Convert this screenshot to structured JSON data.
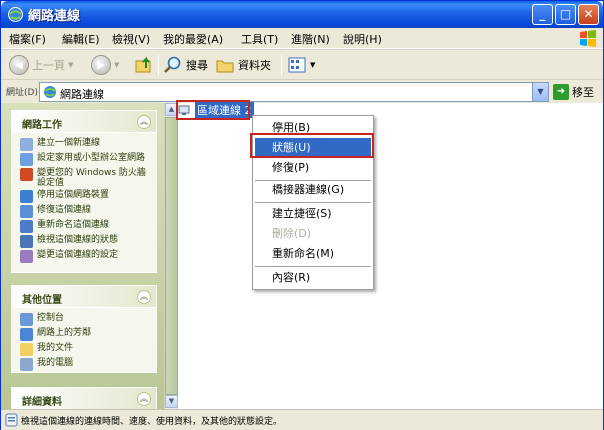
{
  "window": {
    "title": "網路連線",
    "minimize": "_",
    "maximize": "□",
    "close": "✕"
  },
  "menubar": {
    "items": [
      "檔案(F)",
      "編輯(E)",
      "檢視(V)",
      "我的最愛(A)",
      "工具(T)",
      "進階(N)",
      "說明(H)"
    ]
  },
  "toolbar": {
    "back": "上一頁",
    "search": "搜尋",
    "folders": "資料夾"
  },
  "address": {
    "label": "網址(D)",
    "value": "網路連線",
    "go": "移至"
  },
  "taskpane": {
    "network_tasks": {
      "title": "網路工作",
      "items": [
        "建立一個新連線",
        "設定家用或小型辦公室網路",
        "變更您的 Windows 防火牆設定值",
        "停用這個網路裝置",
        "修復這個連線",
        "重新命名這個連線",
        "檢視這個連線的狀態",
        "變更這個連線的設定"
      ]
    },
    "other_places": {
      "title": "其他位置",
      "items": [
        "控制台",
        "網路上的芳鄰",
        "我的文件",
        "我的電腦"
      ]
    },
    "details": {
      "title": "詳細資料"
    }
  },
  "content": {
    "selected_item": "區域連線 2"
  },
  "context_menu": {
    "items": [
      {
        "label": "停用(B)",
        "state": "normal"
      },
      {
        "label": "狀態(U)",
        "state": "selected"
      },
      {
        "label": "修復(P)",
        "state": "normal"
      },
      {
        "label": "橋接器連線(G)",
        "state": "normal"
      },
      {
        "label": "建立捷徑(S)",
        "state": "normal"
      },
      {
        "label": "刪除(D)",
        "state": "disabled"
      },
      {
        "label": "重新命名(M)",
        "state": "normal"
      },
      {
        "label": "內容(R)",
        "state": "normal"
      }
    ]
  },
  "statusbar": {
    "text": "檢視這個連線的連線時間、速度、使用資料，及其他的狀態設定。"
  },
  "colors": {
    "titlebar": "#0a5fe8",
    "selection": "#316ac5",
    "callout": "#c4261f"
  }
}
